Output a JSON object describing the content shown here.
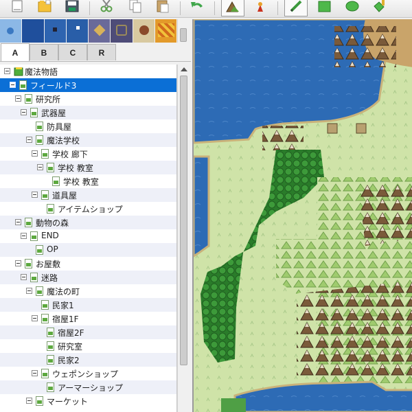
{
  "toolbar": {
    "buttons": [
      {
        "icon": "new-document-icon"
      },
      {
        "icon": "open-folder-icon"
      },
      {
        "icon": "save-disk-icon"
      },
      {
        "icon": "cut-scissors-icon"
      },
      {
        "icon": "copy-icon"
      },
      {
        "icon": "paste-icon"
      },
      {
        "icon": "undo-arrow-icon"
      },
      {
        "icon": "map-mode-icon"
      },
      {
        "icon": "event-mode-icon"
      },
      {
        "icon": "pencil-icon"
      },
      {
        "icon": "rectangle-icon"
      },
      {
        "icon": "ellipse-icon"
      },
      {
        "icon": "fill-bucket-icon"
      }
    ]
  },
  "tileset_tabs": [
    "A",
    "B",
    "C",
    "R"
  ],
  "active_tab": "A",
  "tree": {
    "items": [
      {
        "label": "魔法物語",
        "level": 0,
        "type": "project",
        "expander": true
      },
      {
        "label": "フィールド3",
        "level": 1,
        "type": "map",
        "expander": true,
        "selected": true
      },
      {
        "label": "研究所",
        "level": 2,
        "type": "map",
        "expander": true
      },
      {
        "label": "武器屋",
        "level": 3,
        "type": "map",
        "expander": true
      },
      {
        "label": "防具屋",
        "level": 4,
        "type": "map",
        "expander": false
      },
      {
        "label": "魔法学校",
        "level": 4,
        "type": "map",
        "expander": true
      },
      {
        "label": "学校 廊下",
        "level": 5,
        "type": "map",
        "expander": true
      },
      {
        "label": "学校 教室",
        "level": 6,
        "type": "map",
        "expander": true
      },
      {
        "label": "学校 教室",
        "level": 7,
        "type": "map",
        "expander": false
      },
      {
        "label": "道具屋",
        "level": 5,
        "type": "map",
        "expander": true
      },
      {
        "label": "アイテムショップ",
        "level": 6,
        "type": "map",
        "expander": false
      },
      {
        "label": "動物の森",
        "level": 2,
        "type": "map",
        "expander": true
      },
      {
        "label": "END",
        "level": 3,
        "type": "map",
        "expander": true
      },
      {
        "label": "OP",
        "level": 4,
        "type": "map",
        "expander": false
      },
      {
        "label": "お屋敷",
        "level": 2,
        "type": "map",
        "expander": true
      },
      {
        "label": "迷路",
        "level": 3,
        "type": "map",
        "expander": true
      },
      {
        "label": "魔法の町",
        "level": 4,
        "type": "map",
        "expander": true
      },
      {
        "label": "民家1",
        "level": 5,
        "type": "map",
        "expander": false
      },
      {
        "label": "宿屋1F",
        "level": 5,
        "type": "map",
        "expander": true
      },
      {
        "label": "宿屋2F",
        "level": 6,
        "type": "map",
        "expander": false
      },
      {
        "label": "研究室",
        "level": 6,
        "type": "map",
        "expander": false
      },
      {
        "label": "民家2",
        "level": 6,
        "type": "map",
        "expander": false
      },
      {
        "label": "ウェポンショップ",
        "level": 5,
        "type": "map",
        "expander": true
      },
      {
        "label": "アーマーショップ",
        "level": 6,
        "type": "map",
        "expander": false
      },
      {
        "label": "マーケット",
        "level": 4,
        "type": "map",
        "expander": true
      }
    ]
  },
  "colors": {
    "selection": "#0b6fd6",
    "alt_row": "#eef0f8",
    "water": "#2d6bb5",
    "grass": "#cfe3a8",
    "forest": "#2f8a2f"
  }
}
